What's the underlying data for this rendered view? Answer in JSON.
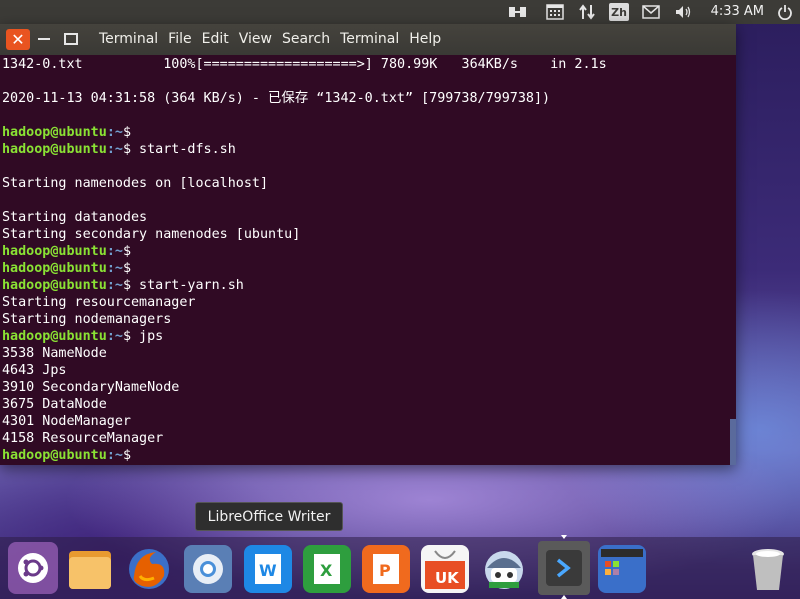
{
  "top_panel": {
    "language": "Zh",
    "clock": "4:33 AM",
    "icons": [
      "network-transfer-icon",
      "calendar-icon",
      "updown-arrows-icon",
      "language-icon",
      "mail-icon",
      "volume-icon",
      "power-icon"
    ]
  },
  "terminal": {
    "menu": [
      "Terminal",
      "File",
      "Edit",
      "View",
      "Search",
      "Terminal",
      "Help"
    ],
    "prompt_user": "hadoop@ubuntu",
    "prompt_path": ":~",
    "prompt_symbol": "$",
    "lines": [
      {
        "type": "text",
        "text": "1342-0.txt          100%[===================>] 780.99K   364KB/s    in 2.1s"
      },
      {
        "type": "text",
        "text": ""
      },
      {
        "type": "text",
        "text": "2020-11-13 04:31:58 (364 KB/s) - 已保存 “1342-0.txt” [799738/799738])"
      },
      {
        "type": "text",
        "text": ""
      },
      {
        "type": "prompt",
        "cmd": ""
      },
      {
        "type": "prompt",
        "cmd": " start-dfs.sh"
      },
      {
        "type": "text",
        "text": ""
      },
      {
        "type": "text",
        "text": "Starting namenodes on [localhost]"
      },
      {
        "type": "text",
        "text": ""
      },
      {
        "type": "text",
        "text": "Starting datanodes"
      },
      {
        "type": "text",
        "text": "Starting secondary namenodes [ubuntu]"
      },
      {
        "type": "prompt",
        "cmd": ""
      },
      {
        "type": "prompt",
        "cmd": ""
      },
      {
        "type": "prompt",
        "cmd": " start-yarn.sh"
      },
      {
        "type": "text",
        "text": "Starting resourcemanager"
      },
      {
        "type": "text",
        "text": "Starting nodemanagers"
      },
      {
        "type": "prompt",
        "cmd": " jps"
      },
      {
        "type": "text",
        "text": "3538 NameNode"
      },
      {
        "type": "text",
        "text": "4643 Jps"
      },
      {
        "type": "text",
        "text": "3910 SecondaryNameNode"
      },
      {
        "type": "text",
        "text": "3675 DataNode"
      },
      {
        "type": "text",
        "text": "4301 NodeManager"
      },
      {
        "type": "text",
        "text": "4158 ResourceManager"
      },
      {
        "type": "prompt",
        "cmd": ""
      }
    ]
  },
  "dock": {
    "tooltip": "LibreOffice Writer",
    "items": [
      {
        "name": "ubuntu-dash-icon",
        "color": "#6b3a8a"
      },
      {
        "name": "files-folder-icon",
        "color": "#f0a030"
      },
      {
        "name": "firefox-icon",
        "color": "#e66000"
      },
      {
        "name": "chromium-icon",
        "color": "#5a7fb5"
      },
      {
        "name": "libreoffice-writer-icon",
        "color": "#1e88e5"
      },
      {
        "name": "libreoffice-calc-icon",
        "color": "#2e9e3e"
      },
      {
        "name": "libreoffice-impress-icon",
        "color": "#f06a1e"
      },
      {
        "name": "ubuntu-software-icon",
        "color": "#f5f5f5",
        "label": "UK"
      },
      {
        "name": "software-updater-icon",
        "color": "#8fa8c8"
      },
      {
        "name": "terminal-icon",
        "color": "#4a4a4a"
      },
      {
        "name": "workspace-switcher-icon",
        "color": "#3a6fc9"
      },
      {
        "name": "trash-icon",
        "color": "#cccccc"
      }
    ]
  }
}
